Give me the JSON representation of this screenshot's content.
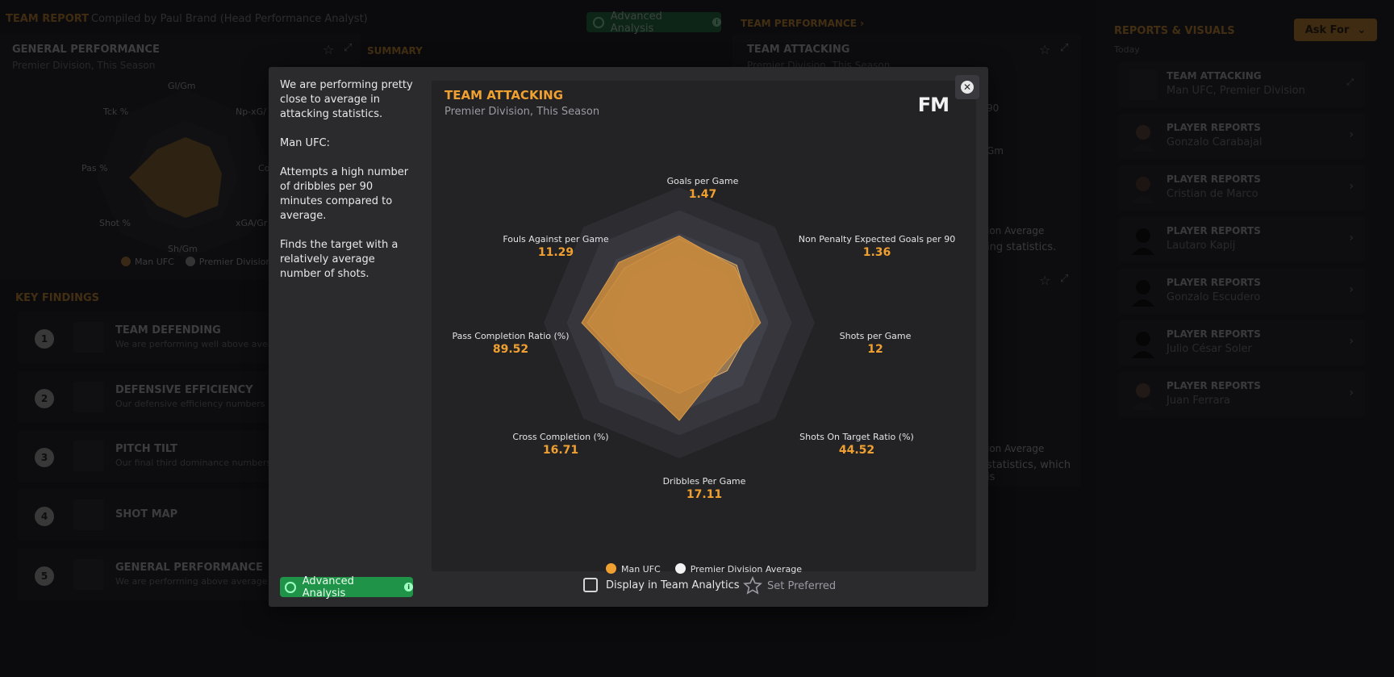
{
  "header": {
    "title": "TEAM REPORT",
    "compiled_by": "Compiled by Paul Brand (Head Performance Analyst)",
    "advanced_analysis": "Advanced Analysis"
  },
  "general_performance": {
    "title": "GENERAL PERFORMANCE",
    "subtitle": "Premier Division, This Season",
    "axes": [
      "Gl/Gm",
      "Np-xG/",
      "Co",
      "xGA/Gr",
      "Sh/Gm",
      "Shot %",
      "Pas %",
      "Tck %"
    ],
    "legend": [
      "Man UFC",
      "Premier Division"
    ]
  },
  "summary": {
    "title": "SUMMARY"
  },
  "key_findings": {
    "title": "KEY FINDINGS",
    "items": [
      {
        "num": "1",
        "title": "TEAM DEFENDING",
        "desc": "We are performing well above averag"
      },
      {
        "num": "2",
        "title": "DEFENSIVE EFFICIENCY",
        "desc": "Our defensive efficiency numbers m"
      },
      {
        "num": "3",
        "title": "PITCH TILT",
        "desc": "Our final third dominance numbers"
      },
      {
        "num": "4",
        "title": "SHOT MAP",
        "desc": ""
      },
      {
        "num": "5",
        "title": "GENERAL PERFORMANCE",
        "desc": "We are performing above average st"
      }
    ]
  },
  "team_performance": {
    "link": "TEAM PERFORMANCE",
    "card_title": "TEAM ATTACKING",
    "card_sub": "Premier Division, This Season",
    "fragments": [
      "90",
      "Gm",
      "ion Average",
      "ing statistics.",
      "ion Average",
      "statistics, which is"
    ]
  },
  "reports": {
    "title": "REPORTS & VISUALS",
    "date": "Today",
    "ask_for": "Ask For",
    "items": [
      {
        "title": "TEAM ATTACKING",
        "sub": "Man UFC, Premier Division"
      },
      {
        "title": "PLAYER REPORTS",
        "sub": "Gonzalo Carabajal"
      },
      {
        "title": "PLAYER REPORTS",
        "sub": "Cristian de Marco"
      },
      {
        "title": "PLAYER REPORTS",
        "sub": "Lautaro Kapij"
      },
      {
        "title": "PLAYER REPORTS",
        "sub": "Gonzalo Escudero"
      },
      {
        "title": "PLAYER REPORTS",
        "sub": "Julio César Soler"
      },
      {
        "title": "PLAYER REPORTS",
        "sub": "Juan Ferrara"
      }
    ]
  },
  "modal": {
    "summary": [
      "We are performing pretty close to average in attacking statistics.",
      "Man UFC:",
      "Attempts a high number of dribbles per 90 minutes compared to average.",
      "Finds the target with a relatively average number of shots."
    ],
    "title": "TEAM ATTACKING",
    "subtitle": "Premier Division, This Season",
    "logo": "FM",
    "advanced_analysis": "Advanced Analysis",
    "display_in_team_analytics": "Display in Team Analytics",
    "set_preferred": "Set Preferred"
  },
  "colors": {
    "accent": "#f0a030",
    "team_fill": "#c98a3c",
    "green": "#1f9448"
  },
  "chart_data": {
    "type": "radar",
    "title": "TEAM ATTACKING",
    "subtitle": "Premier Division, This Season",
    "axes": [
      {
        "name": "Goals per Game",
        "value": "1.47",
        "team": 0.64,
        "avg": 0.62
      },
      {
        "name": "Non Penalty Expected Goals per 90",
        "value": "1.36",
        "team": 0.58,
        "avg": 0.6
      },
      {
        "name": "Shots per Game",
        "value": "12",
        "team": 0.6,
        "avg": 0.55
      },
      {
        "name": "Shots On Target Ratio (%)",
        "value": "44.52",
        "team": 0.45,
        "avg": 0.5
      },
      {
        "name": "Dribbles Per Game",
        "value": "17.11",
        "team": 0.72,
        "avg": 0.52
      },
      {
        "name": "Cross Completion (%)",
        "value": "16.71",
        "team": 0.52,
        "avg": 0.5
      },
      {
        "name": "Pass Completion Ratio (%)",
        "value": "89.52",
        "team": 0.72,
        "avg": 0.68
      },
      {
        "name": "Fouls Against per Game",
        "value": "11.29",
        "team": 0.63,
        "avg": 0.57
      }
    ],
    "series": [
      {
        "name": "Man UFC",
        "color": "#f0a030"
      },
      {
        "name": "Premier Division Average",
        "color": "#f2f2f2"
      }
    ]
  }
}
